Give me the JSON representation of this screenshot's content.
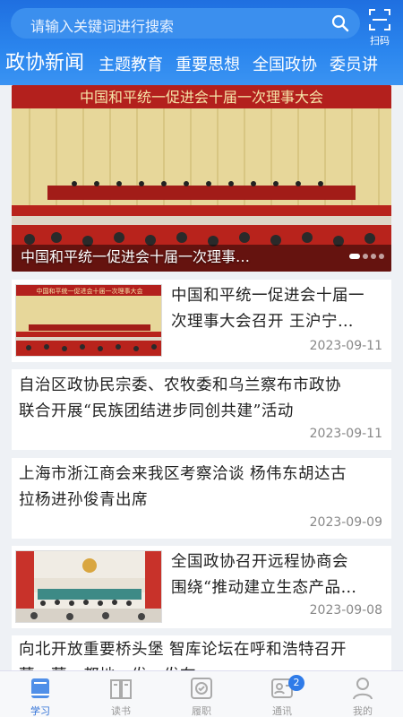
{
  "search": {
    "placeholder": "请输入关键词进行搜索",
    "scan_label": "扫码"
  },
  "tabs": [
    {
      "label": "政协新闻",
      "active": true
    },
    {
      "label": "主题教育"
    },
    {
      "label": "重要思想"
    },
    {
      "label": "全国政协"
    },
    {
      "label": "委员讲"
    }
  ],
  "banner": {
    "image_heading": "中国和平统一促进会十届一次理事大会",
    "caption": "中国和平统一促进会十届一次理事…",
    "slide_count": 4,
    "active_slide": 0
  },
  "news": [
    {
      "title_lines": [
        "中国和平统一促进会十届一",
        "次理事大会召开 王沪宁…"
      ],
      "thumb_heading": "中国和平统一促进会十届一次理事大会",
      "date": "2023-09-11",
      "has_thumb": true
    },
    {
      "title_lines": [
        "自治区政协民宗委、农牧委和乌兰察布市政协",
        "联合开展“民族团结进步同创共建”活动"
      ],
      "date": "2023-09-11",
      "has_thumb": false
    },
    {
      "title_lines": [
        "上海市浙江商会来我区考察洽谈 杨伟东胡达古",
        "拉杨进孙俊青出席"
      ],
      "date": "2023-09-09",
      "has_thumb": false
    },
    {
      "title_lines": [
        "全国政协召开远程协商会",
        "围绕“推动建立生态产品…"
      ],
      "date": "2023-09-08",
      "has_thumb": true
    },
    {
      "title_lines": [
        "向北开放重要桥头堡 智库论坛在呼和浩特召开",
        "蒙…蒙…都地…发…发布"
      ],
      "date": "",
      "has_thumb": false
    }
  ],
  "bottom_nav": [
    {
      "label": "学习",
      "icon": "study-icon",
      "active": true
    },
    {
      "label": "读书",
      "icon": "book-icon"
    },
    {
      "label": "履职",
      "icon": "duty-icon"
    },
    {
      "label": "通讯",
      "icon": "contacts-icon",
      "badge": "2"
    },
    {
      "label": "我的",
      "icon": "profile-icon"
    }
  ],
  "colors": {
    "header": "#2b86ee",
    "banner_red": "#b3201d",
    "active_nav": "#2d6fd6"
  }
}
